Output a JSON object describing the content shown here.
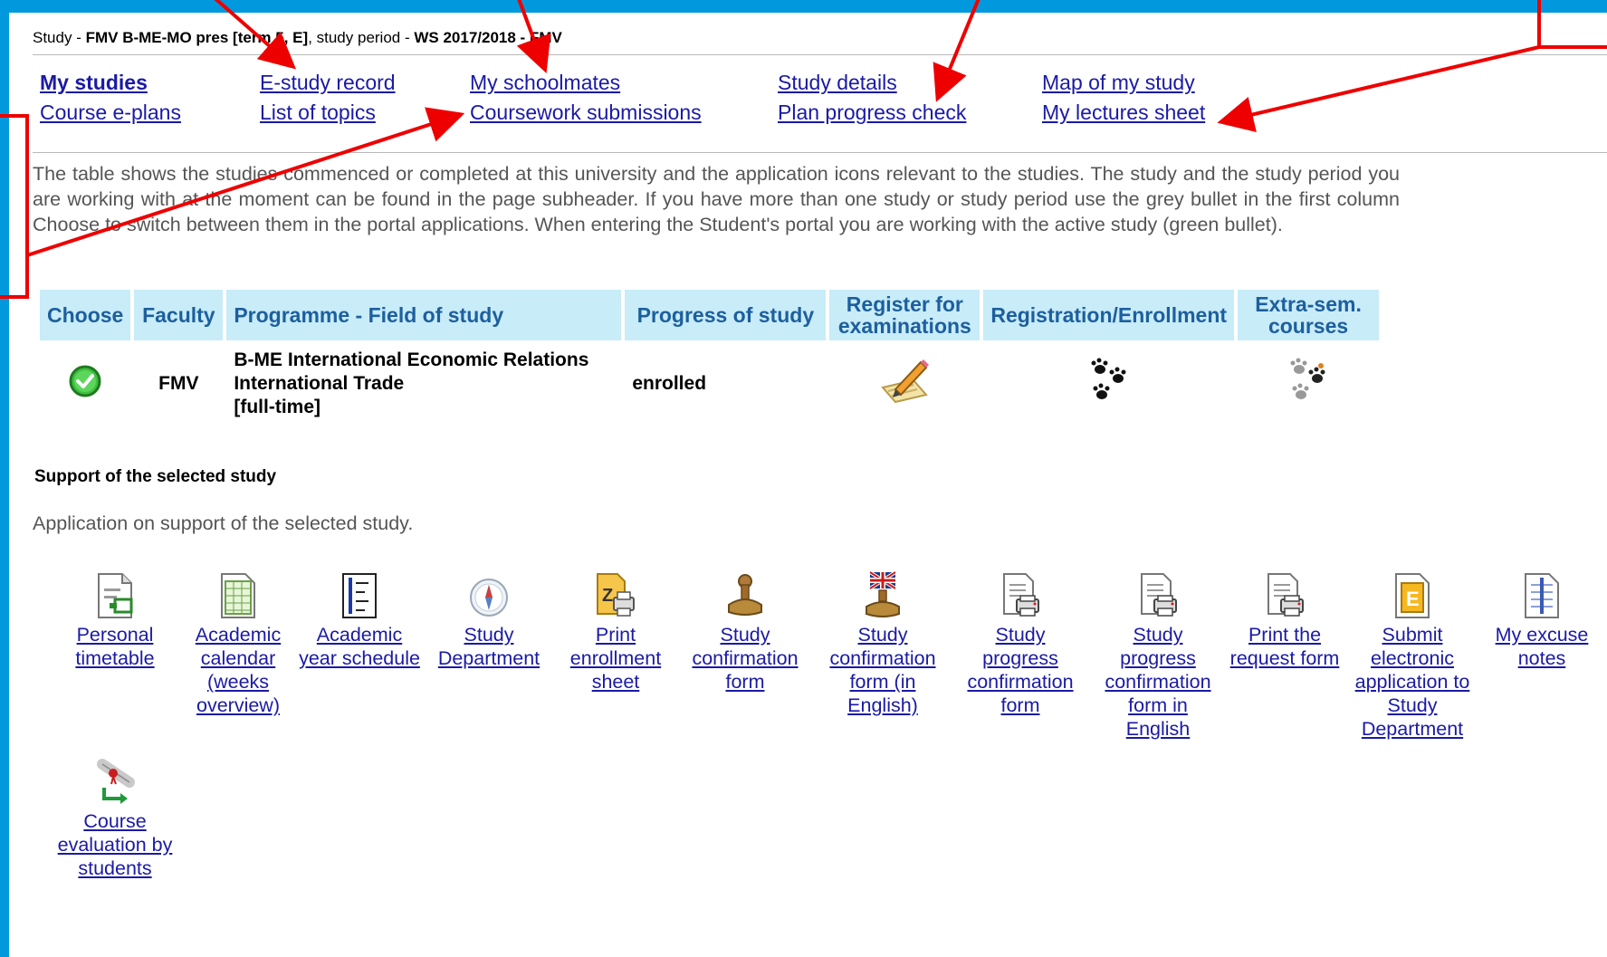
{
  "subheader": {
    "prefix": "Study - ",
    "study": "FMV B-ME-MO pres [term 5, E]",
    "mid": ", study period - ",
    "period": "WS 2017/2018 - FMV"
  },
  "nav": {
    "my_studies": "My studies",
    "course_eplans": "Course e-plans",
    "estudy_record": "E-study record",
    "list_of_topics": "List of topics",
    "my_schoolmates": "My schoolmates",
    "coursework": "Coursework submissions",
    "study_details": "Study details",
    "plan_progress": "Plan progress check",
    "map_of_study": "Map of my study",
    "lectures_sheet": "My lectures sheet"
  },
  "description": "The table shows the studies commenced or completed at this university and the application icons relevant to the studies. The study and the study period you are working with at the moment can be found in the page subheader. If you have more than one study or study period use the grey bullet in the first column Choose to switch between them in the portal applications. When entering the Student's portal you are working with the active study (green bullet).",
  "table": {
    "headers": [
      "Choose",
      "Faculty",
      "Programme - Field of study",
      "Progress of study",
      "Register for examinations",
      "Registration/Enrollment",
      "Extra-sem. courses"
    ],
    "row": {
      "faculty": "FMV",
      "programme_line1": "B-ME International Economic Relations",
      "programme_line2": "International Trade",
      "programme_line3": "[full-time]",
      "progress": "enrolled"
    }
  },
  "support": {
    "title": "Support of the selected study",
    "description": "Application on support of the selected study.",
    "tools": [
      "Personal timetable",
      "Academic calendar (weeks overview)",
      "Academic year schedule",
      "Study Department",
      "Print enrollment sheet",
      "Study confirmation form",
      "Study confirmation form (in English)",
      "Study progress confirmation form",
      "Study progress confirmation form in English",
      "Print the request form",
      "Submit electronic application to Study Department",
      "My excuse notes",
      "Course evaluation by students"
    ]
  },
  "colors": {
    "background_frame": "#0099dd",
    "link": "#1a1aa6",
    "header_bg": "#c8ecf8",
    "header_text": "#1d5f9e",
    "annotation_arrow": "#ee0000"
  }
}
